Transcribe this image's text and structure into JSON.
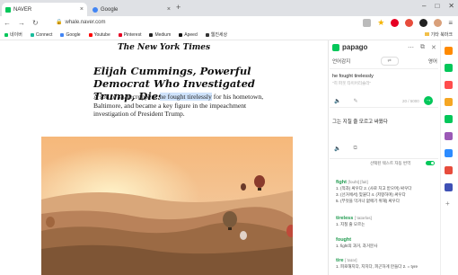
{
  "tabs": [
    {
      "label": "NAVER",
      "active": true,
      "favicon_color": "#03c75a"
    },
    {
      "label": "Google",
      "active": false,
      "favicon_color": "#4285f4"
    }
  ],
  "new_tab": "+",
  "window_controls": [
    "–",
    "□",
    "✕"
  ],
  "address": {
    "url": "whale.naver.com"
  },
  "bookmarks": [
    {
      "label": "네이버",
      "color": "#03c75a"
    },
    {
      "label": "Connect",
      "color": "#1abc9c"
    },
    {
      "label": "Google",
      "color": "#4285f4"
    },
    {
      "label": "Youtube",
      "color": "#ff0000"
    },
    {
      "label": "Pinterest",
      "color": "#e60023"
    },
    {
      "label": "Medium",
      "color": "#222222"
    },
    {
      "label": "Apeed",
      "color": "#111111"
    },
    {
      "label": "웹진세상",
      "color": "#333333"
    }
  ],
  "bookmarks_other": "기타 북마크",
  "article": {
    "masthead": "The New York Times",
    "headline": "Elijah Cummings, Powerful Democrat Who Investigated Trump, Dies at 68",
    "body_before": "A son of sharecroppers, ",
    "body_highlight": "he fought tirelessly",
    "body_after": " for his hometown, Baltimore, and became a key figure in the impeachment investigation of President Trump."
  },
  "papago": {
    "title": "papago",
    "source_lang": "언어감지",
    "target_lang": "영어",
    "source_text": "he fought tirelessly",
    "source_sub": "\"히 파웃 타이어리슬리\"",
    "char_count": "20 / 5000",
    "target_text": "그는 지칠 줄 모르고 싸웠다",
    "dict_toggle_label": "선택된 텍스트 자동 번역",
    "dict": [
      {
        "word": "fight",
        "pron": "[fouht] [fait]",
        "lines": [
          "1. (적과) 싸우다  2. (사로 치고 받으며) 싸우다",
          "3. (선거에서) 맞붙다  4. (저항하며) 싸우다",
          "5. (무엇을 막거나 없애기 위해) 싸우다"
        ]
      },
      {
        "word": "tireless",
        "pron": "[ˈtaɪərləs]",
        "lines": [
          "1. 지칠 줄 모르는"
        ]
      },
      {
        "word": "fought",
        "pron": "",
        "lines": [
          "1. fight의 과거, 과거분사"
        ]
      },
      {
        "word": "tire",
        "pron": "[ˈtaɪər]",
        "lines": [
          "1. 피로해지다, 지치다, 피곤하게 만들다  2. = tyre"
        ]
      }
    ]
  },
  "rail_colors": [
    "#ff8a00",
    "#03c75a",
    "#ff4d4d",
    "#f5a623",
    "#03c75a",
    "#9b59b6",
    "#2d8cff",
    "#e74c3c",
    "#3f51b5"
  ]
}
